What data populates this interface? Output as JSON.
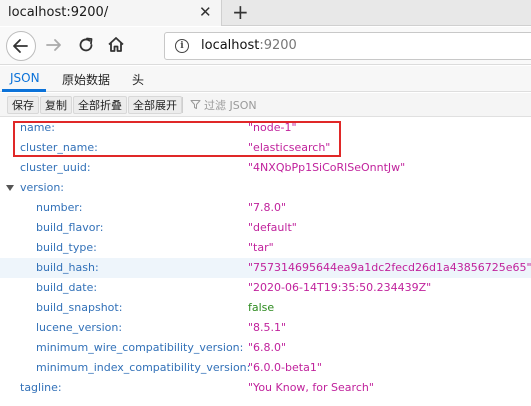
{
  "browser": {
    "tab_title": "localhost:9200/",
    "tab_close": "✕",
    "new_tab": "+",
    "url_host": "localhost",
    "url_port": ":9200"
  },
  "viewer": {
    "tabs": [
      "JSON",
      "原始数据",
      "头"
    ],
    "active_tab": "JSON",
    "toolbar": [
      "保存",
      "复制",
      "全部折叠",
      "全部展开"
    ],
    "filter_placeholder": "过滤 JSON"
  },
  "json_rows": [
    {
      "key": "name:",
      "value": "\"node-1\""
    },
    {
      "key": "cluster_name:",
      "value": "\"elasticsearch\""
    },
    {
      "key": "cluster_uuid:",
      "value": "\"4NXQbPp1SiCoRlSeOnntJw\""
    },
    {
      "key": "version:",
      "value": ""
    },
    {
      "key": "number:",
      "value": "\"7.8.0\""
    },
    {
      "key": "build_flavor:",
      "value": "\"default\""
    },
    {
      "key": "build_type:",
      "value": "\"tar\""
    },
    {
      "key": "build_hash:",
      "value": "\"757314695644ea9a1dc2fecd26d1a43856725e65\""
    },
    {
      "key": "build_date:",
      "value": "\"2020-06-14T19:35:50.234439Z\""
    },
    {
      "key": "build_snapshot:",
      "value": "false"
    },
    {
      "key": "lucene_version:",
      "value": "\"8.5.1\""
    },
    {
      "key": "minimum_wire_compatibility_version:",
      "value": "\"6.8.0\""
    },
    {
      "key": "minimum_index_compatibility_version:",
      "value": "\"6.0.0-beta1\""
    },
    {
      "key": "tagline:",
      "value": "\"You Know, for Search\""
    }
  ],
  "colors": {
    "key": "#3271b8",
    "string": "#c0229c",
    "boolean": "#2c8a1e",
    "accent": "#0b72d9",
    "annotation": "#e02828"
  }
}
